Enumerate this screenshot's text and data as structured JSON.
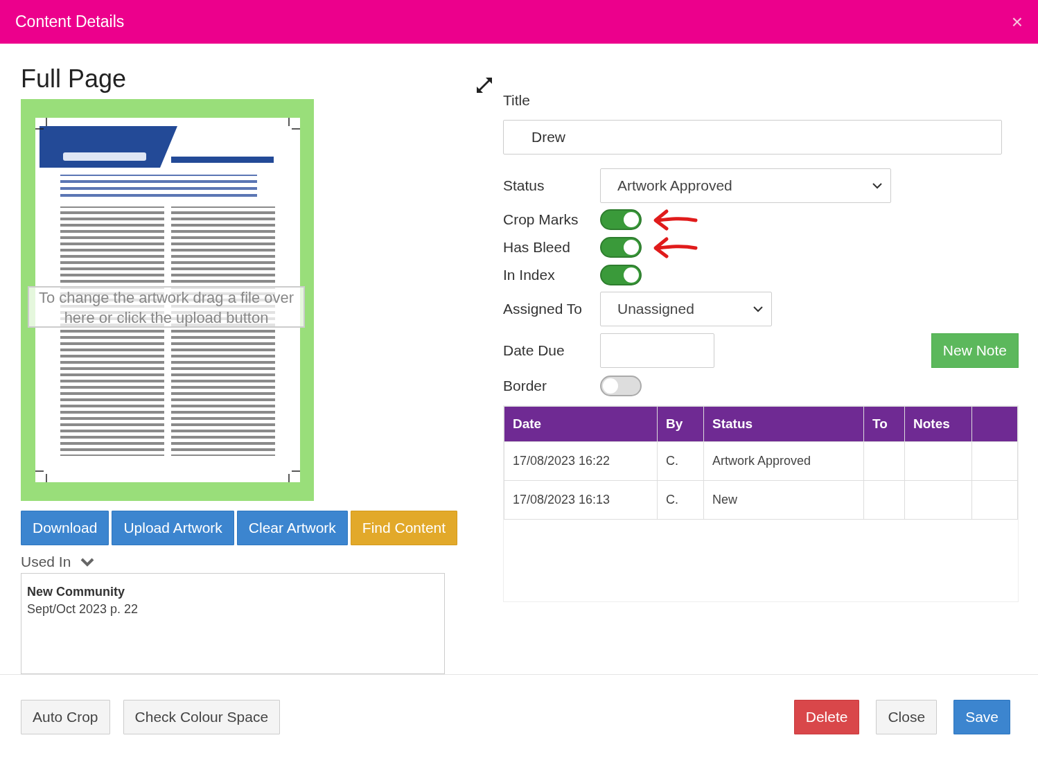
{
  "window": {
    "title": "Content Details",
    "close": "×"
  },
  "preview": {
    "heading": "Full Page",
    "overlay": "To change the artwork drag a file over here or click the upload button",
    "buttons": [
      {
        "label": "Download",
        "kind": "primary"
      },
      {
        "label": "Upload Artwork",
        "kind": "primary"
      },
      {
        "label": "Clear Artwork",
        "kind": "primary"
      },
      {
        "label": "Find Content",
        "kind": "warning"
      }
    ],
    "used_in": {
      "label": "Used In",
      "expanded": true,
      "entries": [
        {
          "publication": "New Community",
          "issue": "Sept/Oct 2023 p. 22"
        }
      ]
    }
  },
  "form": {
    "title": {
      "label": "Title",
      "value": "Drew"
    },
    "fields": [
      {
        "kind": "select",
        "label": "Status",
        "value": "Artwork Approved"
      },
      {
        "kind": "toggle",
        "label": "Crop Marks",
        "on": true,
        "annotation_arrow": true
      },
      {
        "kind": "toggle",
        "label": "Has Bleed",
        "on": true,
        "annotation_arrow": true
      },
      {
        "kind": "toggle",
        "label": "In Index",
        "on": true,
        "annotation_arrow": false
      },
      {
        "kind": "select-short",
        "label": "Assigned To",
        "value": "Unassigned"
      },
      {
        "kind": "date",
        "label": "Date Due",
        "action": "New Note"
      },
      {
        "kind": "toggle",
        "label": "Border",
        "on": false,
        "annotation_arrow": false
      }
    ],
    "history": {
      "columns": [
        "Date",
        "By",
        "Status",
        "To",
        "Notes"
      ],
      "rows": [
        [
          "17/08/2023 16:22",
          "C.",
          "Artwork Approved",
          "",
          ""
        ],
        [
          "17/08/2023 16:13",
          "C.",
          "New",
          "",
          ""
        ]
      ]
    }
  },
  "footer": {
    "left": [
      "Auto Crop",
      "Check Colour Space"
    ],
    "right": [
      {
        "label": "Delete",
        "kind": "danger"
      },
      {
        "label": "Close",
        "kind": "default"
      },
      {
        "label": "Save",
        "kind": "primary"
      }
    ]
  }
}
